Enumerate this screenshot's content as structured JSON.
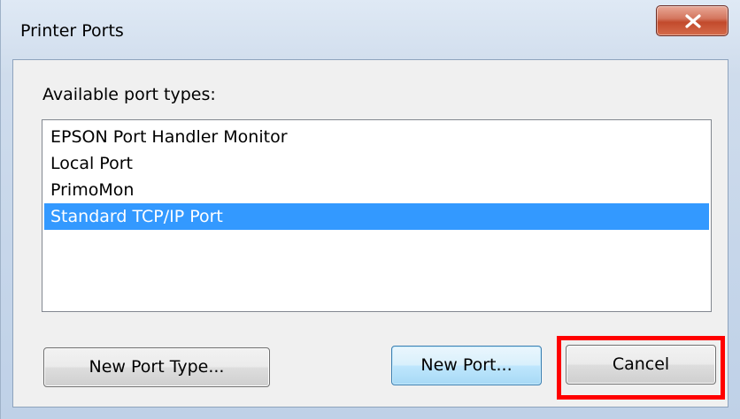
{
  "window": {
    "title": "Printer Ports"
  },
  "dialog": {
    "label": "Available port types:",
    "port_types": [
      "EPSON Port Handler Monitor",
      "Local Port",
      "PrimoMon",
      "Standard TCP/IP Port"
    ],
    "selected_index": 3,
    "buttons": {
      "new_port_type": "New Port Type...",
      "new_port": "New Port...",
      "cancel": "Cancel"
    }
  },
  "icons": {
    "close": "close-icon"
  },
  "colors": {
    "selection": "#3399ff",
    "highlight": "#ff0000",
    "close_button": "#c24a2c"
  }
}
